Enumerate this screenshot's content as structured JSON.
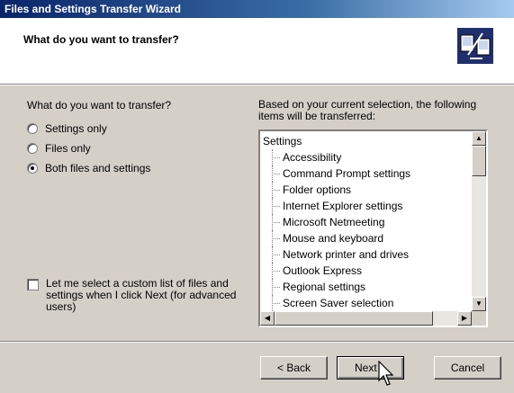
{
  "window": {
    "title": "Files and Settings Transfer Wizard"
  },
  "header": {
    "title": "What do you want to transfer?",
    "icon": "transfer-wizard-icon"
  },
  "left": {
    "label": "What do you want to transfer?",
    "options": [
      {
        "label": "Settings only",
        "checked": false
      },
      {
        "label": "Files only",
        "checked": false
      },
      {
        "label": "Both files and settings",
        "checked": true
      }
    ],
    "custom_checkbox": {
      "label": "Let me select a custom list of files and settings when I click Next (for advanced users)",
      "checked": false
    }
  },
  "right": {
    "label": "Based on your current selection, the following items will be transferred:",
    "tree": {
      "root": "Settings",
      "items": [
        "Accessibility",
        "Command Prompt settings",
        "Folder options",
        "Internet Explorer settings",
        "Microsoft Netmeeting",
        "Mouse and keyboard",
        "Network printer and drives",
        "Outlook Express",
        "Regional settings",
        "Screen Saver selection"
      ]
    }
  },
  "buttons": {
    "back": "< Back",
    "next": "Next >",
    "cancel": "Cancel"
  },
  "colors": {
    "titlebar_start": "#0a246a",
    "titlebar_end": "#a6caf0",
    "face": "#d4d0c8"
  }
}
